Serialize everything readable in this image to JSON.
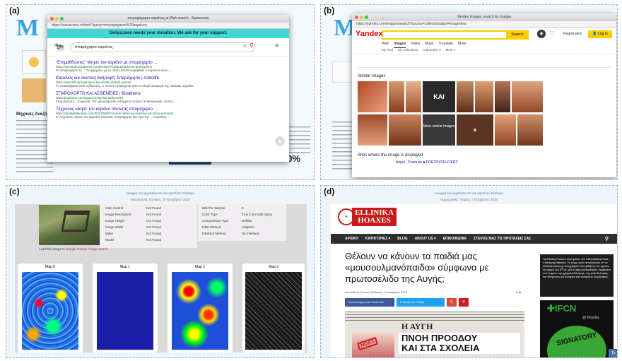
{
  "panels": {
    "a": {
      "tag": "(a)",
      "bg_title": "Μηχανές Αναζήτ",
      "bg_percent": "50%",
      "window": {
        "title": "στεραράχαρτο καρκίνος at Web search - Swisscows",
        "address": "https://swisscows.ch/web?query=στεραράχαρτο%20καρκίνος",
        "banner": "Swisscows needs your donation. We ask for your support.",
        "search_value": "σπαράχαρτο καρκίνος",
        "results": [
          {
            "title": "\"Επιμαθδώσεις\" νίκησε τον καρκίνο με σπαράχαρτο ...",
            "url": "https://aeostali.wordpress.com/2010/07/19/antimarkinos-anti-karkino",
            "snippet": "Το σπαράχαρτο το ... Το φάρμακο με το οποίο καταπολεμήθηκε ο καρκίνος είναι ..."
          },
          {
            "title": "Καρκίνος και ολιστική διατροφή: Σπαράχαρτο | Astrolife",
            "url": "https://astrolife.gr/eparkinos-kai-olistiki-diatrofi-sparax",
            "snippet": "Το σπαράχαρτο είναι ο βλαστός, ο οποίος προέρχεται από το κλαρί αναφορά της παλαιάς αρχαίας."
          },
          {
            "title": "ΣΠΑΡΟΧΟΡΤΟ ΚΑΙ ΑΣΘΕΝΕΙΕΣ | Bioathens",
            "url": "www.bioathens.com/sparochorto-kai-astheneies",
            "snippet": "Σπαράχαρτο ... Καρκίνος: Στη χλωροφύλλη υπάρχουν πολλές αντικαρκινικές ουσίες, ..."
          },
          {
            "title": "74χρονος νίκησε τον καρκίνο πίνοντας σπαράχαρτο ...",
            "url": "https://enallaktikinews.com/2010/08/07/xronos-nikise-ton-karkino-pinontas-starxorto",
            "snippet": "Ο 74χρονος νίκησε τον καρκίνο πίνοντας σπαράχαρτο δεν έχει την ... Καρκίνος ..."
          }
        ]
      }
    },
    "b": {
      "tag": "(b)",
      "window": {
        "title": "Yandex.Images: search for images",
        "address": "https://yandex.com/images/search?source=collections&rpt=imageview",
        "logo": "Yandex",
        "search_button": "Search",
        "registration": "Registration",
        "login": "Log in",
        "tabs": [
          "Web",
          "Images",
          "Video",
          "Maps",
          "Translate",
          "More"
        ],
        "subtabs": [
          "My feed",
          "My collections",
          "Categories ▾",
          "More ▾"
        ],
        "similar_heading": "Similar images",
        "more_label": "More similar images",
        "kai_label": "KAI",
        "sites_heading": "Sites where the image is displayed",
        "site_link": "Angel - Poem by",
        "site_name": "POETRYDELIVERY"
      }
    },
    "c": {
      "tag": "(c)",
      "top_link": "Ανοιγμα του εργαλείου σε νέα καρτέλα | Κλείσιμο",
      "date_text": "Ημερομηνία: Κυριακή, 25 Νοεμβρίου 2018",
      "props_left": [
        [
          "Gain Control",
          "Not Found"
        ],
        [
          "Image Description",
          "Not Found"
        ],
        [
          "Image Height",
          "Not Found"
        ],
        [
          "Image Width",
          "Not Found"
        ],
        [
          "Make",
          "Not Found"
        ],
        [
          "Model",
          "Not Found"
        ]
      ],
      "props_right": [
        [
          "Bits Per Sample",
          "8"
        ],
        [
          "Color Type",
          "True Color with Alpha"
        ],
        [
          "Compression Type",
          "Deflate"
        ],
        [
          "Filter Method",
          "Adaptive"
        ],
        [
          "Interlace Method",
          "No Interlace"
        ]
      ],
      "caption_pre": "Load this image to",
      "caption_link": "Google reverse image search",
      "maps": [
        "Map 0",
        "Map 1",
        "Map 2",
        "Map 3"
      ]
    },
    "d": {
      "tag": "(d)",
      "top_link": "Ανοιγμα του εργαλείου σε νέα καρτέλα | Κλείσιμο",
      "date_text": "Ημερομηνία: Τετάρτη, 7 Νοεμβρίου 2018",
      "site_line1": "ELLINIKA",
      "site_line2": "HOAXES",
      "nav": [
        "ΑΡΧΙΚΗ",
        "ΚΑΤΗΓΟΡΙΕΣ ▾",
        "BLOG",
        "ABOUT US ▾",
        "ΕΠΙΚΟΙΝΩΝΙΑ",
        "ΣΤΕΙΛΤΕ ΜΑΣ ΤΙΣ ΠΡΟΤΑΣΕΙΣ ΣΑΣ"
      ],
      "headline": "Θέλουν να κάνουν τα παιδιά μας «μουσουλμανόπαιδα» σύμφωνα με πρωτοσέλιδο της Αυγής;",
      "byline": "Από Θάνος Σιτίστας (Sitistas) - 7 Νοεμβρίου 2018",
      "comments": "0",
      "share_fb": "Κοινοποίηση στο Facebook",
      "share_tw": "Tweet στο Twitter",
      "sidebar_text": "Τα Ellinika Hoaxes είναι μέλος του International Fact-Checking Network. Το σήμα αυτό αποδεικνύει ότι τα ellinikahoaxes.gr ελέγχθηκαν και κρίθηκαν ότι τηρούν τις αρχές του IFCN, για πλήρη ανεξαρτησία, διαφάνεια των πηγών, της χρηματοδότησης, της μεθοδολογίας, και δέσμευση για ανοιχτές και ειλικρινείς διορθώσεις.",
      "ifcn": "IFCN",
      "poynter": "@ Poynter.",
      "signatory": "SIGNATORY",
      "newspaper_title": "Η ΑΥΓΗ",
      "newspaper_head1": "ΠΝΟΗ ΠΡΟΟΔΟΥ",
      "newspaper_head2": "ΚΑΙ ΣΤΑ ΣΧΟΛΕΙΑ",
      "hoax_stamp": "HOAX"
    }
  },
  "colors": {
    "panel_border": "#8fb6d6",
    "swisscows_banner": "#3fd6d6",
    "link_blue": "#1a0dab",
    "url_green": "#0b7a21",
    "yandex_red": "#e00",
    "yandex_yellow": "#ffcc00",
    "hoaxes_red": "#c91a1a",
    "navbar": "#2f2f2f",
    "ifcn_green": "#3aa635"
  }
}
